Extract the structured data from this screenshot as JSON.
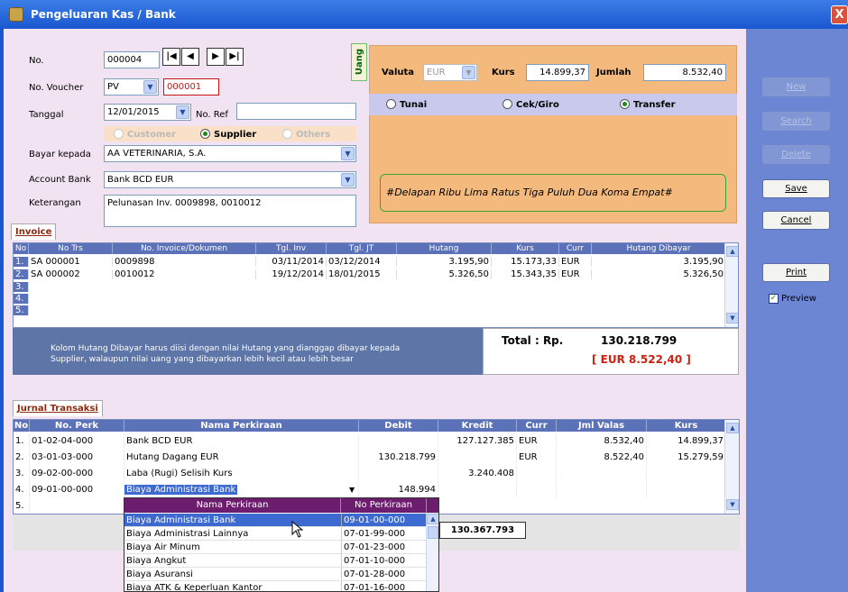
{
  "window": {
    "title": "Pengeluaran Kas / Bank",
    "close": "X"
  },
  "form": {
    "no_label": "No.",
    "no_value": "000004",
    "voucher_label": "No. Voucher",
    "voucher_type": "PV",
    "voucher_value": "000001",
    "tanggal_label": "Tanggal",
    "tanggal_value": "12/01/2015",
    "noref_label": "No. Ref",
    "noref_value": "",
    "radio_customer": "Customer",
    "radio_supplier": "Supplier",
    "radio_others": "Others",
    "bayar_label": "Bayar kepada",
    "bayar_value": "AA VETERINARIA, S.A.",
    "account_label": "Account Bank",
    "account_value": "Bank BCD EUR",
    "ket_label": "Keterangan",
    "ket_value": "Pelunasan Inv. 0009898, 0010012"
  },
  "nav": {
    "first": "|◀",
    "prev": "◀",
    "next": "▶",
    "last": "▶|"
  },
  "uang": {
    "tab": "Uang",
    "valuta_label": "Valuta",
    "valuta_value": "EUR",
    "kurs_label": "Kurs",
    "kurs_value": "14.899,37",
    "jumlah_label": "Jumlah",
    "jumlah_value": "8.532,40",
    "tunai": "Tunai",
    "cek": "Cek/Giro",
    "transfer": "Transfer",
    "terbilang": "#Delapan Ribu Lima Ratus Tiga Puluh Dua Koma Empat#"
  },
  "invoice": {
    "tab": "Invoice",
    "headers": [
      "No",
      "No Trs",
      "No. Invoice/Dokumen",
      "Tgl. Inv",
      "Tgl. JT",
      "Hutang",
      "Kurs",
      "Curr",
      "Hutang Dibayar"
    ],
    "rows": [
      [
        "1.",
        "SA 000001",
        "0009898",
        "03/11/2014",
        "03/12/2014",
        "3.195,90",
        "15.173,33",
        "EUR",
        "3.195,90"
      ],
      [
        "2.",
        "SA 000002",
        "0010012",
        "19/12/2014",
        "18/01/2015",
        "5.326,50",
        "15.343,35",
        "EUR",
        "5.326,50"
      ],
      [
        "3.",
        "",
        "",
        "",
        "",
        "",
        "",
        "",
        ""
      ],
      [
        "4.",
        "",
        "",
        "",
        "",
        "",
        "",
        "",
        ""
      ],
      [
        "5.",
        "",
        "",
        "",
        "",
        "",
        "",
        "",
        ""
      ]
    ],
    "info_line1": "Kolom Hutang Dibayar harus diisi dengan nilai Hutang yang dianggap dibayar kepada",
    "info_line2": "Supplier, walaupun nilai uang yang dibayarkan lebih kecil atau lebih besar",
    "total_label": "Total : Rp.",
    "total_value": "130.218.799",
    "total_eur": "[ EUR  8.522,40 ]"
  },
  "jurnal": {
    "tab": "Jurnal Transaksi",
    "headers": [
      "No",
      "No. Perk",
      "Nama Perkiraan",
      "Debit",
      "Kredit",
      "Curr",
      "Jml Valas",
      "Kurs"
    ],
    "rows": [
      [
        "1.",
        "01-02-04-000",
        "Bank BCD EUR",
        "",
        "127.127.385",
        "EUR",
        "8.532,40",
        "14.899,37"
      ],
      [
        "2.",
        "03-01-03-000",
        "Hutang Dagang EUR",
        "130.218.799",
        "",
        "EUR",
        "8.522,40",
        "15.279,59"
      ],
      [
        "3.",
        "09-02-00-000",
        "Laba (Rugi) Selisih Kurs",
        "",
        "3.240.408",
        "",
        "",
        ""
      ],
      [
        "4.",
        "09-01-00-000",
        "Biaya Administrasi Bank",
        "148.994",
        "",
        "",
        "",
        ""
      ],
      [
        "5.",
        "",
        "",
        "",
        "",
        "",
        "",
        ""
      ]
    ],
    "total": "130.367.793"
  },
  "dropdown": {
    "headers": [
      "Nama Perkiraan",
      "No Perkiraan"
    ],
    "rows": [
      [
        "Biaya Administrasi Bank",
        "09-01-00-000"
      ],
      [
        "Biaya Administrasi Lainnya",
        "07-01-99-000"
      ],
      [
        "Biaya Air Minum",
        "07-01-23-000"
      ],
      [
        "Biaya Angkut",
        "07-01-10-000"
      ],
      [
        "Biaya Asuransi",
        "07-01-28-000"
      ],
      [
        "Biaya ATK & Keperluan Kantor",
        "07-01-16-000"
      ]
    ]
  },
  "side": {
    "new": "New",
    "search": "Search",
    "delete": "Delete",
    "save": "Save",
    "cancel": "Cancel",
    "print": "Print",
    "preview": "Preview"
  }
}
